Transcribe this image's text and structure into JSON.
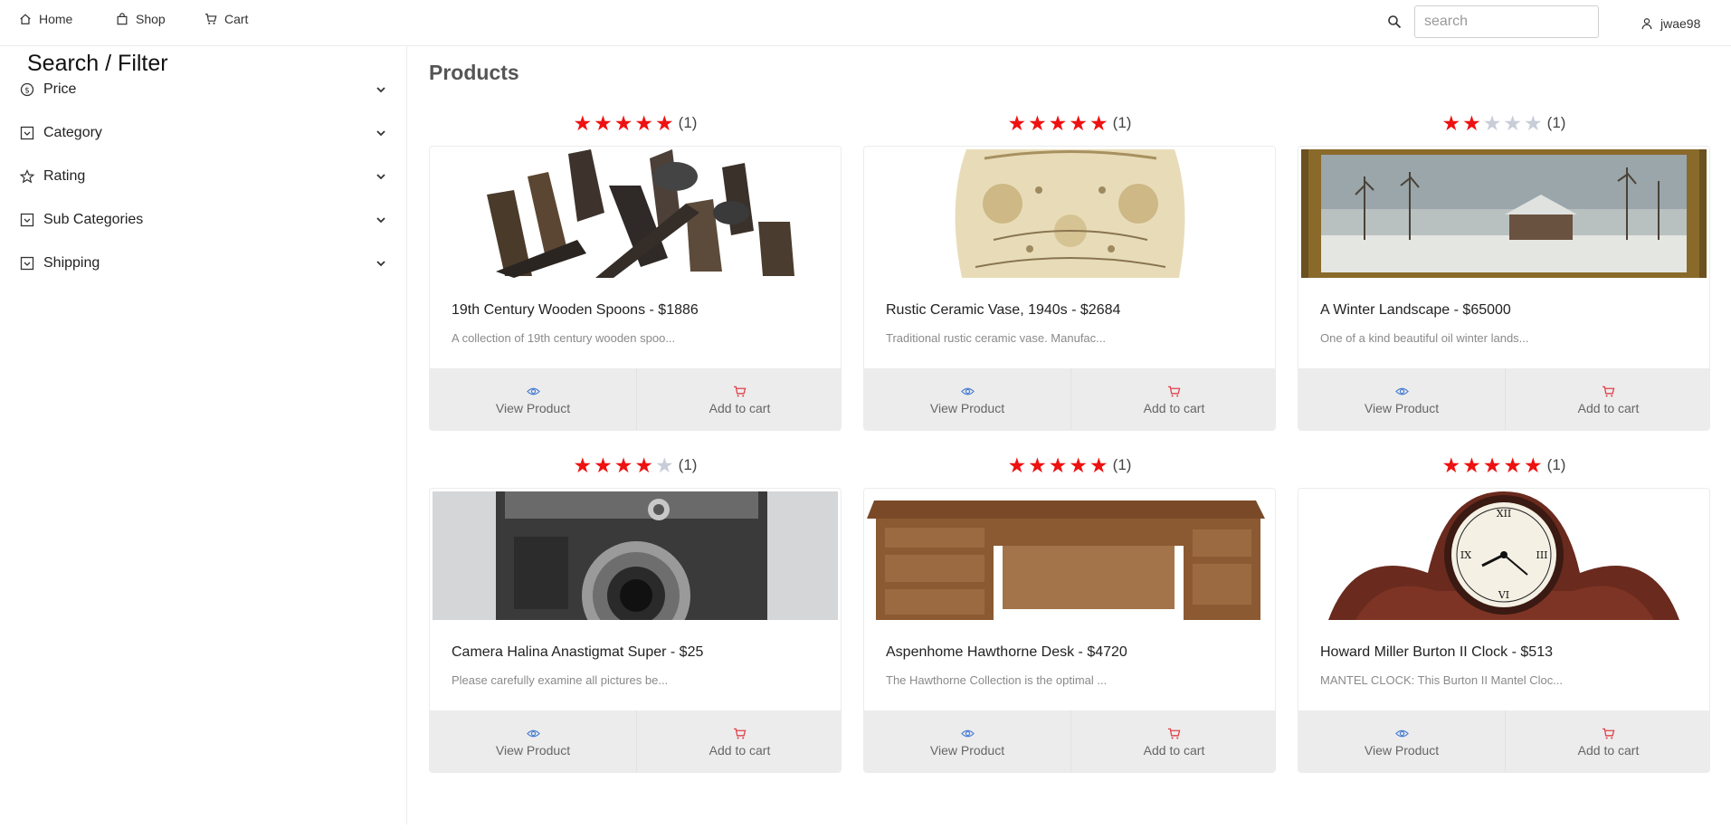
{
  "nav": {
    "home": "Home",
    "shop": "Shop",
    "cart": "Cart",
    "search_placeholder": "search",
    "user": "jwae98"
  },
  "sidebar": {
    "title": "Search / Filter",
    "filters": [
      {
        "label": "Price",
        "icon": "dollar-circle-icon"
      },
      {
        "label": "Category",
        "icon": "checkbox-icon"
      },
      {
        "label": "Rating",
        "icon": "star-outline-icon"
      },
      {
        "label": "Sub Categories",
        "icon": "checkbox-icon"
      },
      {
        "label": "Shipping",
        "icon": "checkbox-icon"
      }
    ]
  },
  "main": {
    "title": "Products",
    "products": [
      {
        "name": "19th Century Wooden Spoons - $1886",
        "desc": "A collection of 19th century wooden spoo...",
        "stars": 5,
        "count": "(1)",
        "view": "View Product",
        "add": "Add to cart"
      },
      {
        "name": "Rustic Ceramic Vase, 1940s - $2684",
        "desc": "Traditional rustic ceramic vase. Manufac...",
        "stars": 5,
        "count": "(1)",
        "view": "View Product",
        "add": "Add to cart"
      },
      {
        "name": "A Winter Landscape - $65000",
        "desc": "One of a kind beautiful oil winter lands...",
        "stars": 2,
        "count": "(1)",
        "view": "View Product",
        "add": "Add to cart"
      },
      {
        "name": "Camera Halina Anastigmat Super - $25",
        "desc": "Please carefully examine all pictures be...",
        "stars": 4,
        "count": "(1)",
        "view": "View Product",
        "add": "Add to cart"
      },
      {
        "name": "Aspenhome Hawthorne Desk - $4720",
        "desc": "The Hawthorne Collection is the optimal ...",
        "stars": 5,
        "count": "(1)",
        "view": "View Product",
        "add": "Add to cart"
      },
      {
        "name": "Howard Miller Burton II Clock - $513",
        "desc": "MANTEL CLOCK: This Burton II Mantel Cloc...",
        "stars": 5,
        "count": "(1)",
        "view": "View Product",
        "add": "Add to cart"
      }
    ]
  },
  "colors": {
    "star_on": "#ee1111",
    "star_off": "#c8cdd8",
    "view_icon": "#4a7fd4",
    "cart_icon": "#e0404a"
  }
}
